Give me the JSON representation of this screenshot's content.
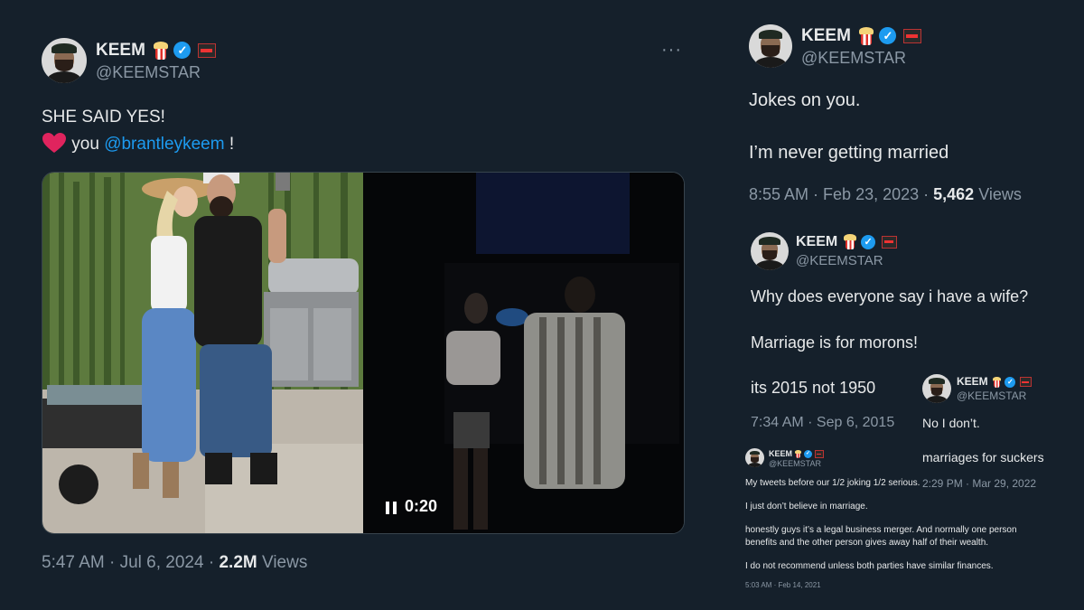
{
  "main_tweet": {
    "name": "KEEM",
    "handle": "@KEEMSTAR",
    "more": "···",
    "line1": "SHE SAID YES!",
    "line2_text": "you",
    "mention": "@brantleykeem",
    "line2_end": "!",
    "video_time": "0:20",
    "time": "5:47 AM",
    "date": "Jul 6, 2024",
    "views_count": "2.2M",
    "views_label": "Views"
  },
  "tweet_2023": {
    "name": "KEEM",
    "handle": "@KEEMSTAR",
    "line1": "Jokes on you.",
    "line2": "I’m never getting married",
    "time": "8:55 AM",
    "date": "Feb 23, 2023",
    "views_count": "5,462",
    "views_label": "Views"
  },
  "tweet_2015": {
    "name": "KEEM",
    "handle": "@KEEMSTAR",
    "line1": "Why does everyone say i have a wife?",
    "line2": "Marriage is for morons!",
    "line3": "its 2015 not 1950",
    "time": "7:34 AM",
    "date": "Sep 6, 2015"
  },
  "tweet_2022": {
    "name": "KEEM",
    "handle": "@KEEMSTAR",
    "line1": "No I don’t.",
    "line2": "marriages for suckers",
    "timestamp": "2:29 PM · Mar 29, 2022"
  },
  "tweet_2021": {
    "name": "KEEM",
    "handle": "@KEEMSTAR",
    "line1": "My tweets before our 1/2 joking 1/2 serious.",
    "line2": "I just don’t believe in marriage.",
    "line3": "honestly guys it’s a legal business merger. And normally one person",
    "line4": "benefits and the other person gives away half of their wealth.",
    "line5": "I do not recommend unless both parties have similar finances.",
    "timestamp": "5:03 AM · Feb 14, 2021"
  },
  "colors": {
    "background": "#15202b",
    "text": "#e7e9ea",
    "secondary": "#8b98a5",
    "link": "#1d9bf0",
    "verified": "#1d9bf0",
    "heart": "#e0245e"
  }
}
